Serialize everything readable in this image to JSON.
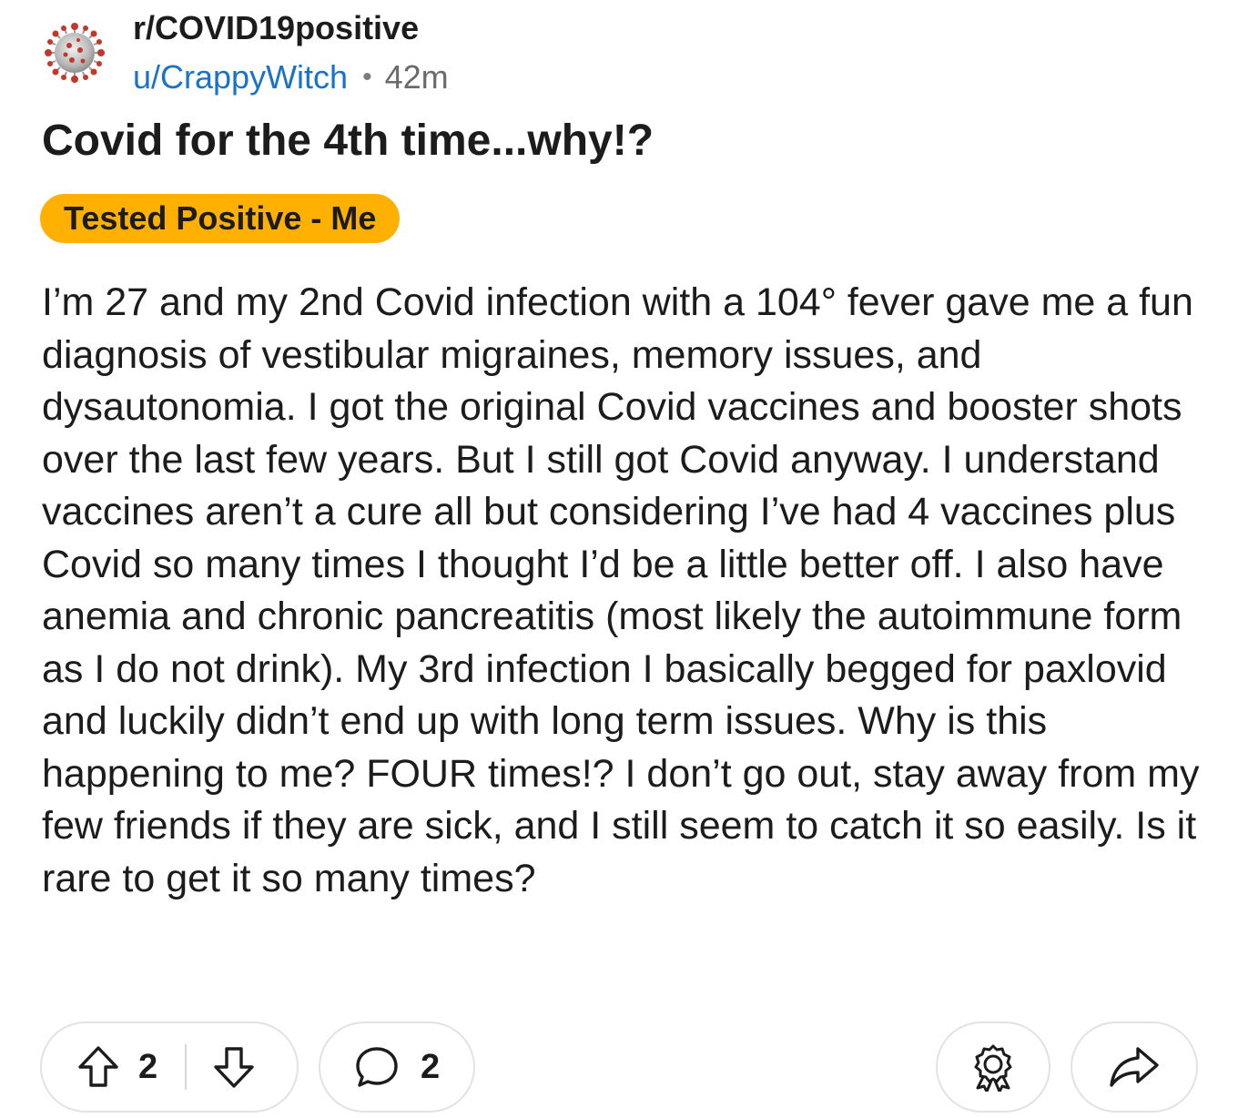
{
  "post": {
    "subreddit": "r/COVID19positive",
    "author": "u/CrappyWitch",
    "separator": "•",
    "age": "42m",
    "title": "Covid for the 4th time...why!?",
    "flair": "Tested Positive - Me",
    "body": "I’m 27 and my 2nd Covid infection with a 104° fever gave me a fun diagnosis of vestibular migraines, memory issues, and dysautonomia. I got the original Covid vaccines and booster shots over the last few years. But I still got Covid anyway. I understand vaccines aren’t a cure all but considering I’ve had 4 vaccines plus Covid so many times I thought I’d be a little better off. I also have anemia and chronic pancreatitis (most likely the autoimmune form as I do not drink). My 3rd infection I basically begged for paxlovid and luckily didn’t end up with long term issues. Why is this happening to me? FOUR times!? I don’t go out, stay away from my few friends if they are sick, and I still seem to catch it so easily. Is it rare to get it so many times?"
  },
  "actions": {
    "vote_count": "2",
    "comment_count": "2"
  },
  "icons": {
    "avatar": "covid-virus-icon",
    "upvote": "upvote-arrow-icon",
    "downvote": "downvote-arrow-icon",
    "comment": "comment-bubble-icon",
    "award": "award-icon",
    "share": "share-arrow-icon"
  },
  "colors": {
    "username": "#1a73c8",
    "flair_bg": "#ffb000",
    "text": "#1c1c1c",
    "muted": "#6b6b6b",
    "pill_border": "#e2e2e2",
    "virus_red": "#c0392b"
  }
}
